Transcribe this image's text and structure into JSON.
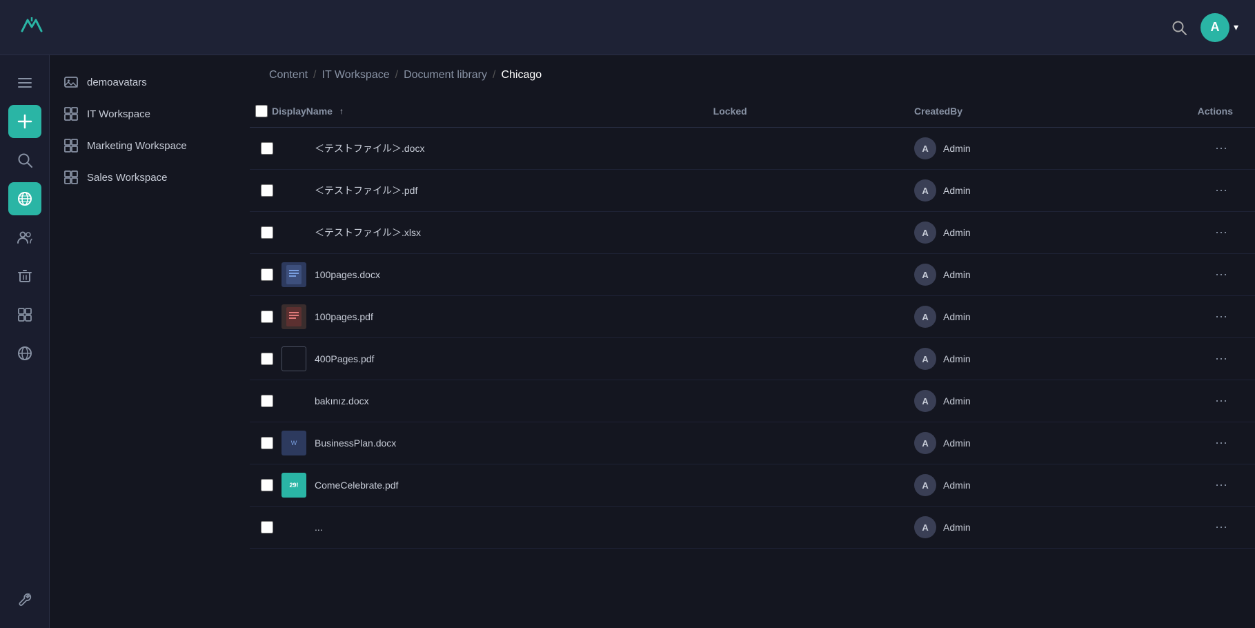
{
  "app": {
    "logo_text": "M",
    "topbar_search_label": "Search",
    "avatar_letter": "A",
    "avatar_chevron": "▾"
  },
  "icon_sidebar": {
    "items": [
      {
        "id": "menu",
        "icon": "☰",
        "active": false,
        "label": "Menu"
      },
      {
        "id": "add",
        "icon": "+",
        "active": false,
        "label": "Add",
        "special": "add"
      },
      {
        "id": "search",
        "icon": "🔍",
        "active": false,
        "label": "Search"
      },
      {
        "id": "globe-active",
        "icon": "🌐",
        "active": true,
        "label": "Global"
      },
      {
        "id": "people",
        "icon": "👥",
        "active": false,
        "label": "People"
      },
      {
        "id": "trash",
        "icon": "🗑",
        "active": false,
        "label": "Trash"
      },
      {
        "id": "widgets",
        "icon": "⊞",
        "active": false,
        "label": "Widgets"
      },
      {
        "id": "globe2",
        "icon": "🌐",
        "active": false,
        "label": "Globe2"
      },
      {
        "id": "wrench",
        "icon": "🔧",
        "active": false,
        "label": "Wrench"
      }
    ]
  },
  "sidebar": {
    "items": [
      {
        "id": "demoavatars",
        "label": "demoavatars",
        "icon": "image"
      },
      {
        "id": "it-workspace",
        "label": "IT Workspace",
        "icon": "grid"
      },
      {
        "id": "marketing-workspace",
        "label": "Marketing Workspace",
        "icon": "grid"
      },
      {
        "id": "sales-workspace",
        "label": "Sales Workspace",
        "icon": "grid"
      }
    ]
  },
  "breadcrumb": {
    "items": [
      {
        "id": "content",
        "label": "Content",
        "current": false
      },
      {
        "id": "it-workspace",
        "label": "IT Workspace",
        "current": false
      },
      {
        "id": "document-library",
        "label": "Document library",
        "current": false
      },
      {
        "id": "chicago",
        "label": "Chicago",
        "current": true
      }
    ]
  },
  "table": {
    "headers": {
      "name": "DisplayName",
      "locked": "Locked",
      "created_by": "CreatedBy",
      "actions": "Actions"
    },
    "rows": [
      {
        "id": 1,
        "name": "＜テストファイル＞.docx",
        "thumb": null,
        "thumb_type": "none",
        "locked": "",
        "created_by": "Admin",
        "avatar": "A"
      },
      {
        "id": 2,
        "name": "＜テストファイル＞.pdf",
        "thumb": null,
        "thumb_type": "none",
        "locked": "",
        "created_by": "Admin",
        "avatar": "A"
      },
      {
        "id": 3,
        "name": "＜テストファイル＞.xlsx",
        "thumb": null,
        "thumb_type": "none",
        "locked": "",
        "created_by": "Admin",
        "avatar": "A"
      },
      {
        "id": 4,
        "name": "100pages.docx",
        "thumb": "docx",
        "thumb_type": "docx",
        "locked": "",
        "created_by": "Admin",
        "avatar": "A"
      },
      {
        "id": 5,
        "name": "100pages.pdf",
        "thumb": "pdf",
        "thumb_type": "pdf",
        "locked": "",
        "created_by": "Admin",
        "avatar": "A"
      },
      {
        "id": 6,
        "name": "400Pages.pdf",
        "thumb": "outline",
        "thumb_type": "outline",
        "locked": "",
        "created_by": "Admin",
        "avatar": "A"
      },
      {
        "id": 7,
        "name": "bakınız.docx",
        "thumb": null,
        "thumb_type": "none",
        "locked": "",
        "created_by": "Admin",
        "avatar": "A"
      },
      {
        "id": 8,
        "name": "BusinessPlan.docx",
        "thumb": "docx-small",
        "thumb_type": "docx-small",
        "locked": "",
        "created_by": "Admin",
        "avatar": "A"
      },
      {
        "id": 9,
        "name": "ComeCelebrate.pdf",
        "thumb": "img",
        "thumb_type": "img",
        "locked": "",
        "created_by": "Admin",
        "avatar": "A"
      },
      {
        "id": 10,
        "name": "...",
        "thumb": null,
        "thumb_type": "none",
        "locked": "",
        "created_by": "Admin",
        "avatar": "A"
      }
    ],
    "actions_label": "⋯"
  }
}
